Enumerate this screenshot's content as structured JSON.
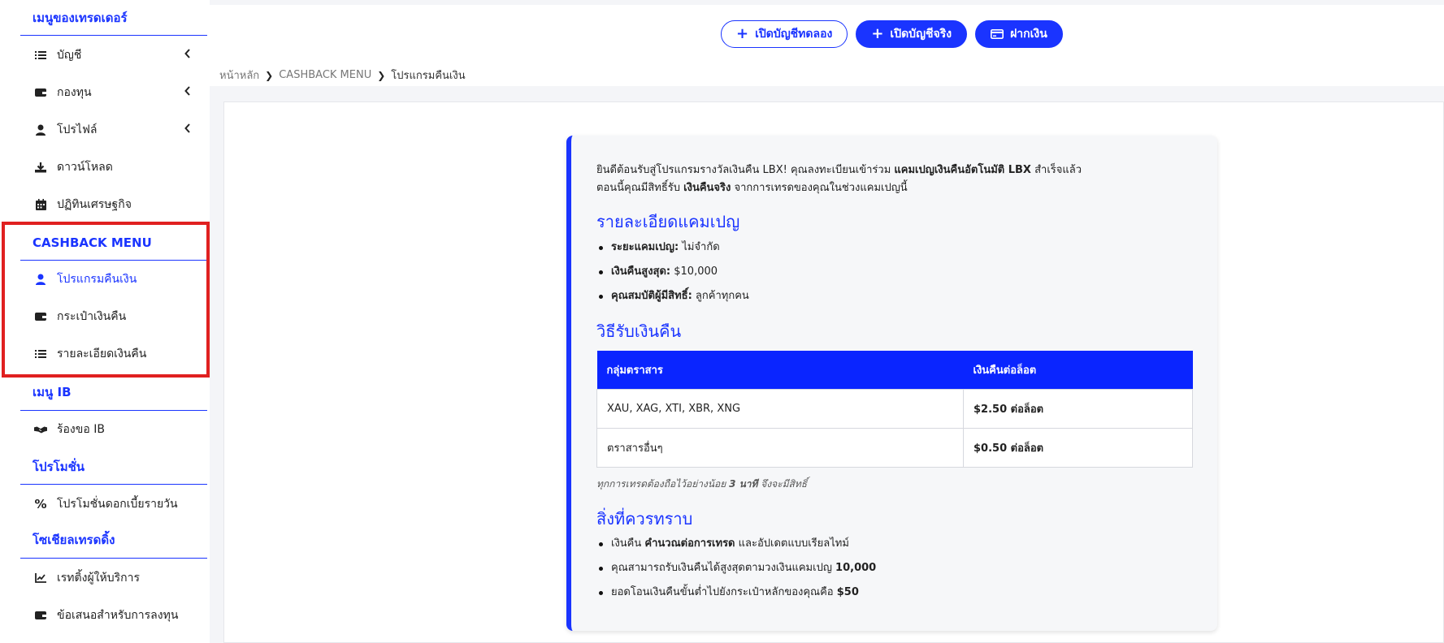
{
  "sidebar": {
    "trader_menu_title": "เมนูของเทรดเดอร์",
    "trader_items": [
      {
        "label": "บัญชี",
        "icon": "list-icon",
        "expandable": true
      },
      {
        "label": "กองทุน",
        "icon": "wallet-icon",
        "expandable": true
      },
      {
        "label": "โปรไฟล์",
        "icon": "user-icon",
        "expandable": true
      },
      {
        "label": "ดาวน์โหลด",
        "icon": "download-icon",
        "expandable": false
      },
      {
        "label": "ปฏิทินเศรษฐกิจ",
        "icon": "calendar-icon",
        "expandable": false
      }
    ],
    "cashback_title": "CASHBACK MENU",
    "cashback_items": [
      {
        "label": "โปรแกรมคืนเงิน",
        "icon": "user-icon",
        "active": true
      },
      {
        "label": "กระเป๋าเงินคืน",
        "icon": "wallet-icon",
        "active": false
      },
      {
        "label": "รายละเอียดเงินคืน",
        "icon": "list-icon",
        "active": false
      }
    ],
    "ib_title": "เมนู IB",
    "ib_items": [
      {
        "label": "ร้องขอ IB",
        "icon": "handshake-icon"
      }
    ],
    "promo_title": "โปรโมชั่น",
    "promo_items": [
      {
        "label": "โปรโมชั่นดอกเบี้ยรายวัน",
        "icon": "percent-icon"
      }
    ],
    "social_title": "โซเชียลเทรดดิ้ง",
    "social_items": [
      {
        "label": "เรทติ้งผู้ให้บริการ",
        "icon": "chart-line-icon"
      },
      {
        "label": "ข้อเสนอสำหรับการลงทุน",
        "icon": "wallet-icon"
      }
    ]
  },
  "header": {
    "demo_button": "เปิดบัญชีทดลอง",
    "real_button": "เปิดบัญชีจริง",
    "deposit_button": "ฝากเงิน"
  },
  "breadcrumb": {
    "home": "หน้าหลัก",
    "section": "CASHBACK MENU",
    "current": "โปรแกรมคืนเงิน"
  },
  "card": {
    "intro_1a": "ยินดีต้อนรับสู่โปรแกรมรางวัลเงินคืน LBX! คุณลงทะเบียนเข้าร่วม ",
    "intro_1b": "แคมเปญเงินคืนอัตโนมัติ LBX",
    "intro_1c": " สำเร็จแล้ว",
    "intro_2a": "ตอนนี้คุณมีสิทธิ์รับ ",
    "intro_2b": "เงินคืนจริง",
    "intro_2c": " จากการเทรดของคุณในช่วงแคมเปญนี้",
    "details_title": "รายละเอียดแคมเปญ",
    "details": [
      {
        "key": "ระยะแคมเปญ:",
        "value": " ไม่จำกัด"
      },
      {
        "key": "เงินคืนสูงสุด:",
        "value": " $10,000"
      },
      {
        "key": "คุณสมบัติผู้มีสิทธิ์:",
        "value": " ลูกค้าทุกคน"
      }
    ],
    "how_title": "วิธีรับเงินคืน",
    "table": {
      "headers": [
        "กลุ่มตราสาร",
        "เงินคืนต่อล็อต"
      ],
      "rows": [
        [
          "XAU, XAG, XTI, XBR, XNG",
          "$2.50 ต่อล็อต"
        ],
        [
          "ตราสารอื่นๆ",
          "$0.50 ต่อล็อต"
        ]
      ]
    },
    "note_a": "ทุกการเทรดต้องถือไว้อย่างน้อย ",
    "note_b": "3 นาที",
    "note_c": " จึงจะมีสิทธิ์",
    "know_title": "สิ่งที่ควรทราบ",
    "know": [
      {
        "a": "เงินคืน ",
        "b": "คำนวณต่อการเทรด",
        "c": " และอัปเดตแบบเรียลไทม์"
      },
      {
        "a": "คุณสามารถรับเงินคืนได้สูงสุดตามวงเงินแคมเปญ ",
        "b": "10,000",
        "c": ""
      },
      {
        "a": "ยอดโอนเงินคืนขั้นต่ำไปยังกระเป๋าหลักของคุณคือ ",
        "b": "$50",
        "c": ""
      }
    ]
  },
  "colors": {
    "accent": "#1a34ff",
    "highlight": "#e02020"
  }
}
